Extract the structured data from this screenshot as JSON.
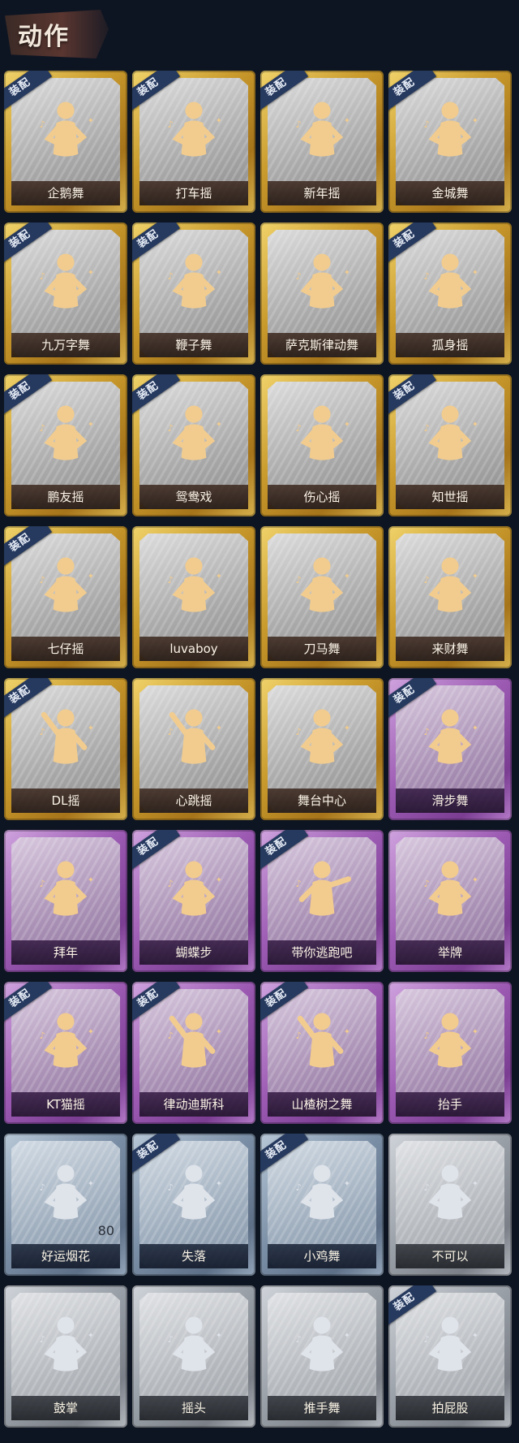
{
  "header": {
    "title": "动作"
  },
  "badge_label": "装配",
  "colors": {
    "gold": "#c99a2c",
    "purple": "#9c5ab3",
    "blue": "#7a8ea5",
    "gray": "#9aa0a8",
    "badge": "#26395e",
    "figure_gold": "#f2cc8e",
    "figure_silver": "#dfe3ea"
  },
  "items": [
    {
      "name": "企鹅舞",
      "tier": "gold",
      "equipped": true,
      "icon": "dance-figure-icon"
    },
    {
      "name": "打车摇",
      "tier": "gold",
      "equipped": true,
      "icon": "dance-figure-icon"
    },
    {
      "name": "新年摇",
      "tier": "gold",
      "equipped": true,
      "icon": "dance-figure-icon"
    },
    {
      "name": "金城舞",
      "tier": "gold",
      "equipped": true,
      "icon": "dance-figure-icon"
    },
    {
      "name": "九万字舞",
      "tier": "gold",
      "equipped": true,
      "icon": "dance-figure-icon"
    },
    {
      "name": "鞭子舞",
      "tier": "gold",
      "equipped": true,
      "icon": "dance-figure-icon"
    },
    {
      "name": "萨克斯律动舞",
      "tier": "gold",
      "equipped": false,
      "icon": "sunglasses-figure-icon"
    },
    {
      "name": "孤身摇",
      "tier": "gold",
      "equipped": true,
      "icon": "dance-figure-icon"
    },
    {
      "name": "鹏友摇",
      "tier": "gold",
      "equipped": true,
      "icon": "dance-figure-icon"
    },
    {
      "name": "鸳鸯戏",
      "tier": "gold",
      "equipped": true,
      "icon": "dance-figure-icon"
    },
    {
      "name": "伤心摇",
      "tier": "gold",
      "equipped": false,
      "icon": "heart-hands-figure-icon"
    },
    {
      "name": "知世摇",
      "tier": "gold",
      "equipped": true,
      "icon": "dance-figure-icon"
    },
    {
      "name": "七仔摇",
      "tier": "gold",
      "equipped": true,
      "icon": "dance-figure-icon"
    },
    {
      "name": "luvaboy",
      "tier": "gold",
      "equipped": false,
      "icon": "dance-figure-icon"
    },
    {
      "name": "刀马舞",
      "tier": "gold",
      "equipped": false,
      "icon": "dance-figure-icon"
    },
    {
      "name": "来财舞",
      "tier": "gold",
      "equipped": false,
      "icon": "dance-figure-icon"
    },
    {
      "name": "DL摇",
      "tier": "gold",
      "equipped": true,
      "icon": "arm-raised-figure-icon"
    },
    {
      "name": "心跳摇",
      "tier": "gold",
      "equipped": false,
      "icon": "arm-raised-figure-icon"
    },
    {
      "name": "舞台中心",
      "tier": "gold",
      "equipped": false,
      "icon": "dance-figure-icon"
    },
    {
      "name": "滑步舞",
      "tier": "purple",
      "equipped": true,
      "icon": "dance-figure-icon"
    },
    {
      "name": "拜年",
      "tier": "purple",
      "equipped": false,
      "icon": "bow-figure-icon"
    },
    {
      "name": "蝴蝶步",
      "tier": "purple",
      "equipped": true,
      "icon": "dance-figure-icon"
    },
    {
      "name": "带你逃跑吧",
      "tier": "purple",
      "equipped": true,
      "icon": "point-figure-icon"
    },
    {
      "name": "举牌",
      "tier": "purple",
      "equipped": false,
      "icon": "sign-figure-icon"
    },
    {
      "name": "KT猫摇",
      "tier": "purple",
      "equipped": true,
      "icon": "dance-figure-icon"
    },
    {
      "name": "律动迪斯科",
      "tier": "purple",
      "equipped": true,
      "icon": "arm-raised-figure-icon"
    },
    {
      "name": "山楂树之舞",
      "tier": "purple",
      "equipped": true,
      "icon": "arm-raised-figure-icon"
    },
    {
      "name": "抬手",
      "tier": "purple",
      "equipped": false,
      "icon": "raise-hand-icon"
    },
    {
      "name": "好运烟花",
      "tier": "blue",
      "equipped": false,
      "icon": "firework-icon",
      "count": "80"
    },
    {
      "name": "失落",
      "tier": "blue",
      "equipped": true,
      "icon": "crawl-figure-icon"
    },
    {
      "name": "小鸡舞",
      "tier": "blue",
      "equipped": true,
      "icon": "dance-figure-icon"
    },
    {
      "name": "不可以",
      "tier": "gray",
      "equipped": false,
      "icon": "finger-wag-icon"
    },
    {
      "name": "鼓掌",
      "tier": "gray",
      "equipped": false,
      "icon": "clap-hands-icon"
    },
    {
      "name": "摇头",
      "tier": "gray",
      "equipped": false,
      "icon": "head-shake-figure-icon"
    },
    {
      "name": "推手舞",
      "tier": "gray",
      "equipped": false,
      "icon": "push-hands-figure-icon"
    },
    {
      "name": "拍屁股",
      "tier": "gray",
      "equipped": true,
      "icon": "dance-figure-icon"
    }
  ]
}
